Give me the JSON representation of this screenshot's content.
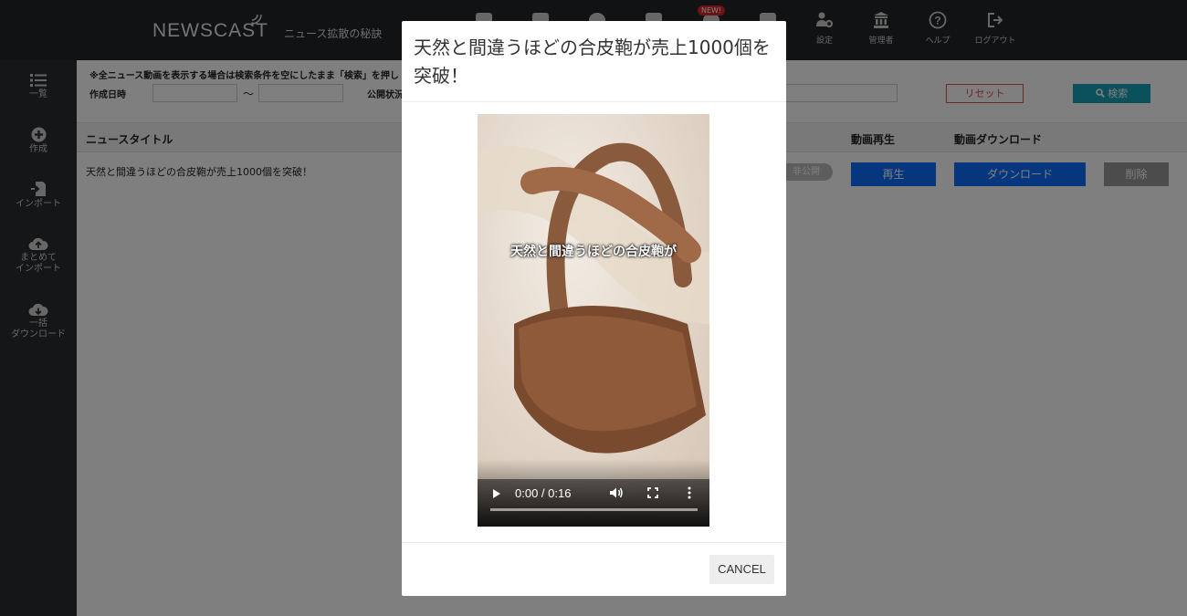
{
  "header": {
    "logo": "NEWSCAST",
    "tagline": "ニュース拡散の秘訣",
    "new_badge": "NEW!",
    "nav": [
      {
        "icon": "settings-icon",
        "label": "設定"
      },
      {
        "icon": "admin-icon",
        "label": "管理者"
      },
      {
        "icon": "help-icon",
        "label": "ヘルプ"
      },
      {
        "icon": "logout-icon",
        "label": "ログアウト"
      }
    ]
  },
  "sidebar": {
    "items": [
      {
        "icon": "list-icon",
        "label": "一覧"
      },
      {
        "icon": "plus-circle-icon",
        "label": "作成"
      },
      {
        "icon": "import-icon",
        "label": "インポート"
      },
      {
        "icon": "cloud-upload-icon",
        "label": "まとめて\nインポート"
      },
      {
        "icon": "cloud-download-icon",
        "label": "一括\nダウンロード"
      }
    ]
  },
  "filters": {
    "note": "※全ニュース動画を表示する場合は検索条件を空にしたまま「検索」を押し",
    "created_label": "作成日時",
    "tilde": "〜",
    "status_label": "公開状況",
    "reset": "リセット",
    "search": "検索"
  },
  "table": {
    "headers": {
      "title": "ニュースタイトル",
      "play": "動画再生",
      "download": "動画ダウンロード"
    },
    "rows": [
      {
        "title": "天然と間違うほどの合皮鞄が売上1000個を突破！",
        "status": "非公開",
        "play": "再生",
        "download": "ダウンロード",
        "delete": "削除"
      }
    ]
  },
  "modal": {
    "title": "天然と間違うほどの合皮鞄が売上1000個を突破！",
    "video_caption": "天然と間違うほどの合皮鞄が",
    "time": "0:00 / 0:16",
    "progress": 0,
    "cancel": "CANCEL"
  }
}
